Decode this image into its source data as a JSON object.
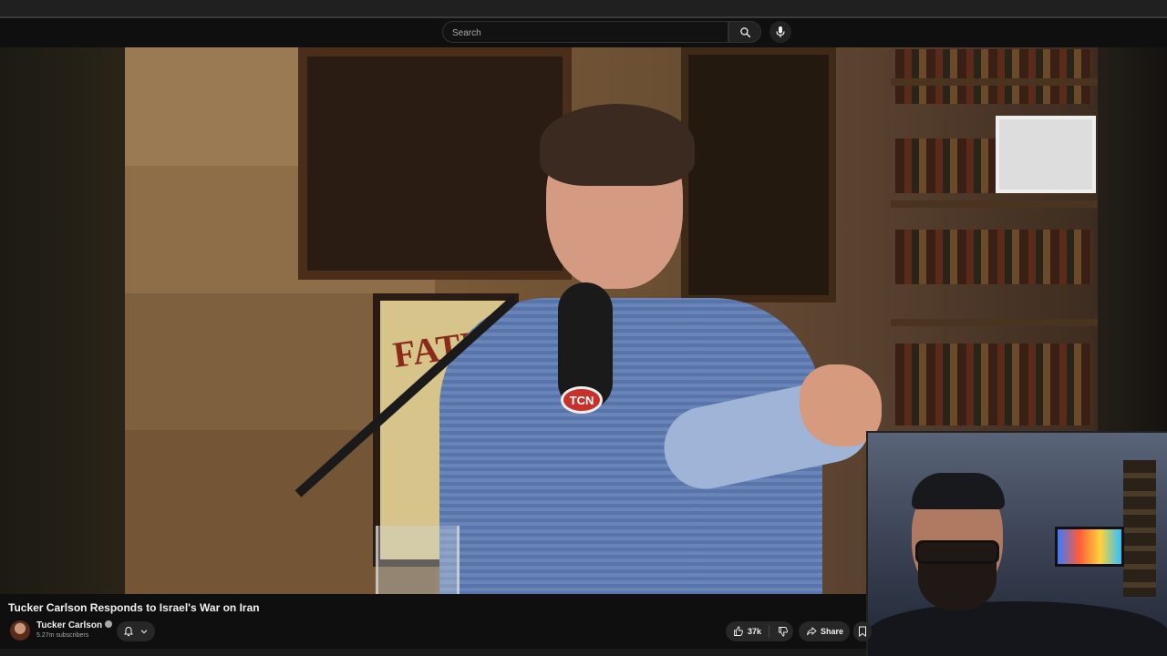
{
  "search": {
    "placeholder": "Search"
  },
  "video": {
    "title": "Tucker Carlson Responds to Israel's War on Iran",
    "poster_text": "FATI",
    "mic_logo": "TCN"
  },
  "channel": {
    "name": "Tucker Carlson",
    "subscribers": "5.27m subscribers"
  },
  "actions": {
    "like_count": "37k",
    "share_label": "Share"
  },
  "icons": {
    "search": "search-icon",
    "mic": "microphone-icon",
    "bell": "bell-icon",
    "chevron": "chevron-down-icon",
    "like": "thumbs-up-icon",
    "dislike": "thumbs-down-icon",
    "share": "share-arrow-icon",
    "verified": "verified-badge-icon"
  }
}
